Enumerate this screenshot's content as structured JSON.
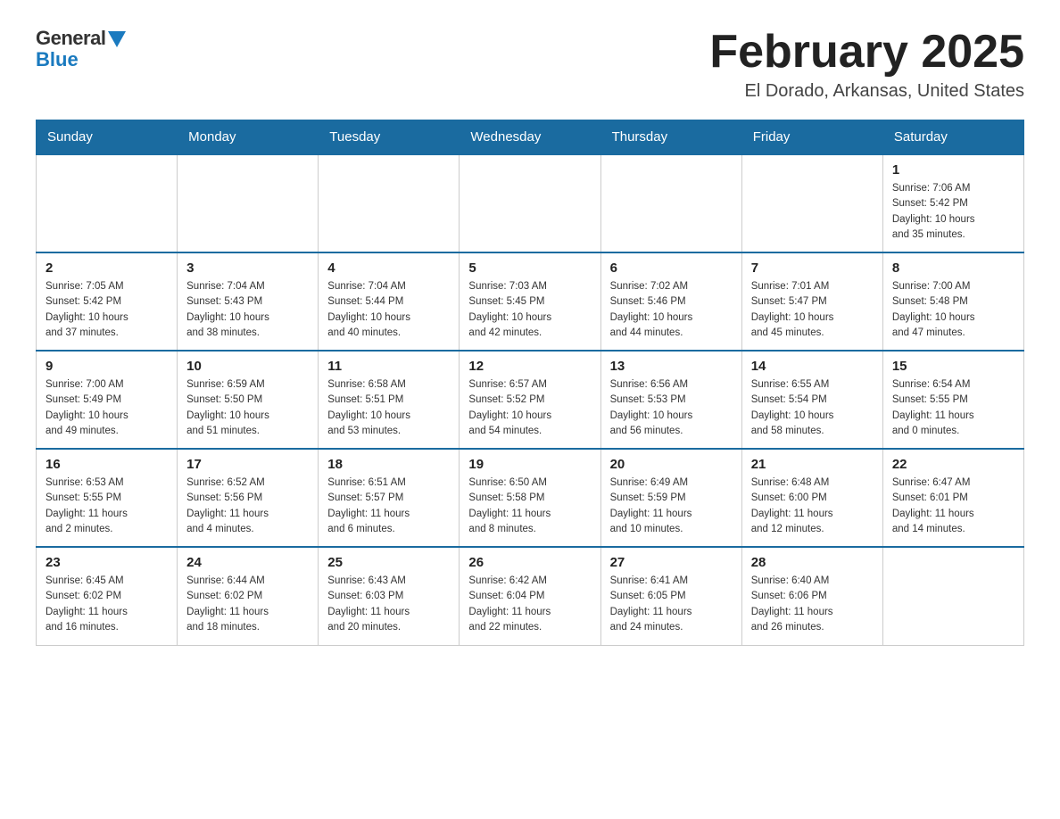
{
  "header": {
    "logo_general": "General",
    "logo_blue": "Blue",
    "month_title": "February 2025",
    "location": "El Dorado, Arkansas, United States"
  },
  "weekdays": [
    "Sunday",
    "Monday",
    "Tuesday",
    "Wednesday",
    "Thursday",
    "Friday",
    "Saturday"
  ],
  "weeks": [
    [
      {
        "day": "",
        "info": ""
      },
      {
        "day": "",
        "info": ""
      },
      {
        "day": "",
        "info": ""
      },
      {
        "day": "",
        "info": ""
      },
      {
        "day": "",
        "info": ""
      },
      {
        "day": "",
        "info": ""
      },
      {
        "day": "1",
        "info": "Sunrise: 7:06 AM\nSunset: 5:42 PM\nDaylight: 10 hours\nand 35 minutes."
      }
    ],
    [
      {
        "day": "2",
        "info": "Sunrise: 7:05 AM\nSunset: 5:42 PM\nDaylight: 10 hours\nand 37 minutes."
      },
      {
        "day": "3",
        "info": "Sunrise: 7:04 AM\nSunset: 5:43 PM\nDaylight: 10 hours\nand 38 minutes."
      },
      {
        "day": "4",
        "info": "Sunrise: 7:04 AM\nSunset: 5:44 PM\nDaylight: 10 hours\nand 40 minutes."
      },
      {
        "day": "5",
        "info": "Sunrise: 7:03 AM\nSunset: 5:45 PM\nDaylight: 10 hours\nand 42 minutes."
      },
      {
        "day": "6",
        "info": "Sunrise: 7:02 AM\nSunset: 5:46 PM\nDaylight: 10 hours\nand 44 minutes."
      },
      {
        "day": "7",
        "info": "Sunrise: 7:01 AM\nSunset: 5:47 PM\nDaylight: 10 hours\nand 45 minutes."
      },
      {
        "day": "8",
        "info": "Sunrise: 7:00 AM\nSunset: 5:48 PM\nDaylight: 10 hours\nand 47 minutes."
      }
    ],
    [
      {
        "day": "9",
        "info": "Sunrise: 7:00 AM\nSunset: 5:49 PM\nDaylight: 10 hours\nand 49 minutes."
      },
      {
        "day": "10",
        "info": "Sunrise: 6:59 AM\nSunset: 5:50 PM\nDaylight: 10 hours\nand 51 minutes."
      },
      {
        "day": "11",
        "info": "Sunrise: 6:58 AM\nSunset: 5:51 PM\nDaylight: 10 hours\nand 53 minutes."
      },
      {
        "day": "12",
        "info": "Sunrise: 6:57 AM\nSunset: 5:52 PM\nDaylight: 10 hours\nand 54 minutes."
      },
      {
        "day": "13",
        "info": "Sunrise: 6:56 AM\nSunset: 5:53 PM\nDaylight: 10 hours\nand 56 minutes."
      },
      {
        "day": "14",
        "info": "Sunrise: 6:55 AM\nSunset: 5:54 PM\nDaylight: 10 hours\nand 58 minutes."
      },
      {
        "day": "15",
        "info": "Sunrise: 6:54 AM\nSunset: 5:55 PM\nDaylight: 11 hours\nand 0 minutes."
      }
    ],
    [
      {
        "day": "16",
        "info": "Sunrise: 6:53 AM\nSunset: 5:55 PM\nDaylight: 11 hours\nand 2 minutes."
      },
      {
        "day": "17",
        "info": "Sunrise: 6:52 AM\nSunset: 5:56 PM\nDaylight: 11 hours\nand 4 minutes."
      },
      {
        "day": "18",
        "info": "Sunrise: 6:51 AM\nSunset: 5:57 PM\nDaylight: 11 hours\nand 6 minutes."
      },
      {
        "day": "19",
        "info": "Sunrise: 6:50 AM\nSunset: 5:58 PM\nDaylight: 11 hours\nand 8 minutes."
      },
      {
        "day": "20",
        "info": "Sunrise: 6:49 AM\nSunset: 5:59 PM\nDaylight: 11 hours\nand 10 minutes."
      },
      {
        "day": "21",
        "info": "Sunrise: 6:48 AM\nSunset: 6:00 PM\nDaylight: 11 hours\nand 12 minutes."
      },
      {
        "day": "22",
        "info": "Sunrise: 6:47 AM\nSunset: 6:01 PM\nDaylight: 11 hours\nand 14 minutes."
      }
    ],
    [
      {
        "day": "23",
        "info": "Sunrise: 6:45 AM\nSunset: 6:02 PM\nDaylight: 11 hours\nand 16 minutes."
      },
      {
        "day": "24",
        "info": "Sunrise: 6:44 AM\nSunset: 6:02 PM\nDaylight: 11 hours\nand 18 minutes."
      },
      {
        "day": "25",
        "info": "Sunrise: 6:43 AM\nSunset: 6:03 PM\nDaylight: 11 hours\nand 20 minutes."
      },
      {
        "day": "26",
        "info": "Sunrise: 6:42 AM\nSunset: 6:04 PM\nDaylight: 11 hours\nand 22 minutes."
      },
      {
        "day": "27",
        "info": "Sunrise: 6:41 AM\nSunset: 6:05 PM\nDaylight: 11 hours\nand 24 minutes."
      },
      {
        "day": "28",
        "info": "Sunrise: 6:40 AM\nSunset: 6:06 PM\nDaylight: 11 hours\nand 26 minutes."
      },
      {
        "day": "",
        "info": ""
      }
    ]
  ]
}
